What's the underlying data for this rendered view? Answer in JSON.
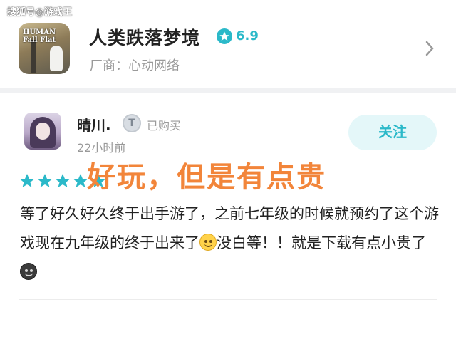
{
  "watermark": "搜狐号@游戏王",
  "game": {
    "cover_text": "HUMAN Fall Flat",
    "title": "人类跌落梦境",
    "rating": "6.9",
    "vendor": "厂商：心动网络"
  },
  "review": {
    "username": "晴川.",
    "badge_letter": "T",
    "purchased_label": "已购买",
    "time_ago": "22小时前",
    "follow_label": "关注",
    "stars": 5,
    "headline": "好玩，但是有点贵",
    "body_part1": "等了好久好久终于出手游了，之前七年级的时候就预约了这个游戏现在九年级的终于出来了",
    "body_part2": "没白等！！就是下载有点小贵了"
  },
  "colors": {
    "accent": "#2bb9c9",
    "headline": "#f2853a",
    "follow_bg": "#e4f7f9"
  },
  "icons": [
    "star-rating-icon",
    "chevron-right-icon",
    "verified-badge-icon",
    "smile-emoji-icon",
    "dark-emoji-icon"
  ]
}
